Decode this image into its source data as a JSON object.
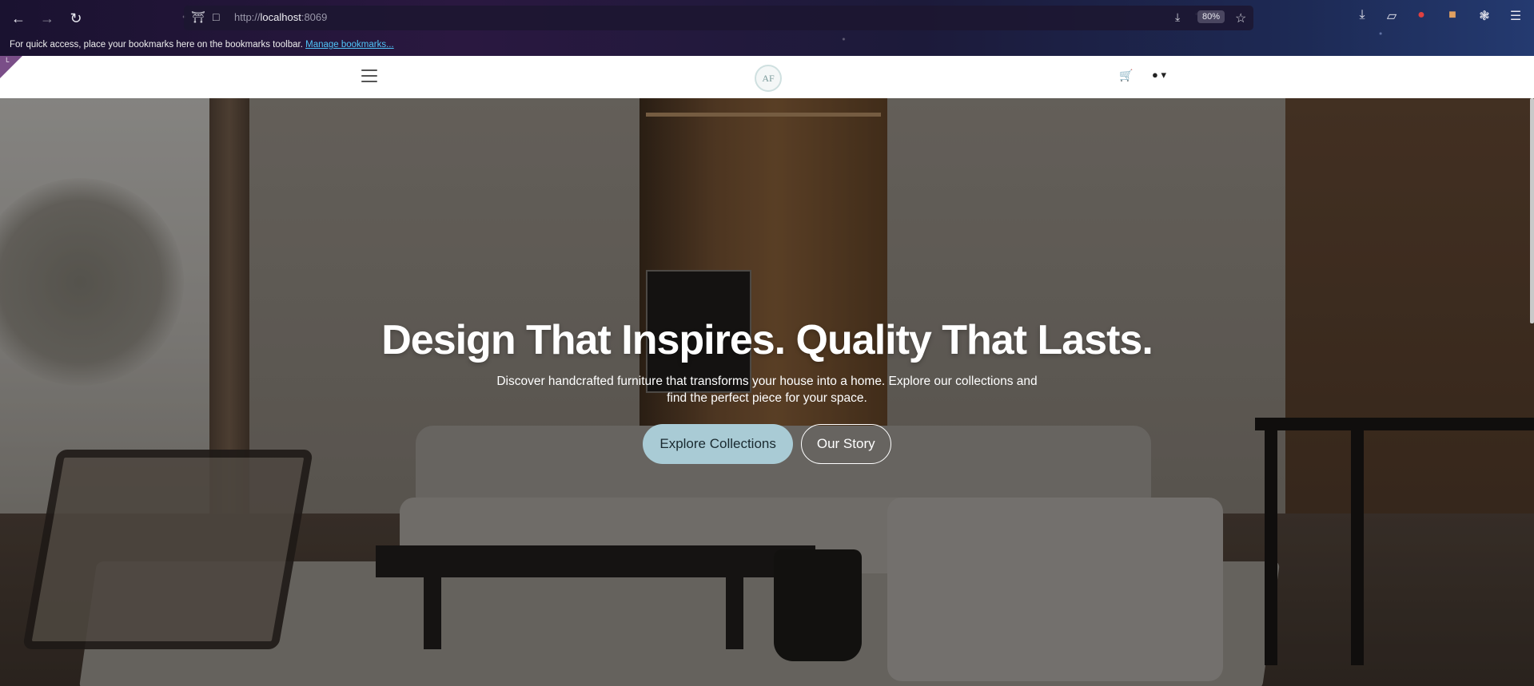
{
  "browser": {
    "url_prefix": "http://",
    "url_host": "localhost",
    "url_port": ":8069",
    "zoom": "80%",
    "bookmarks_message": "For quick access, place your bookmarks here on the bookmarks toolbar.",
    "manage_bookmarks_link": "Manage bookmarks..."
  },
  "header": {
    "logo_text": "AF"
  },
  "hero": {
    "title": "Design That Inspires. Quality That Lasts.",
    "subtitle": "Discover handcrafted furniture that transforms your house into a home. Explore our collections and find the perfect piece for your space.",
    "primary_button": "Explore Collections",
    "secondary_button": "Our Story"
  },
  "colors": {
    "primary_button_bg": "#a9cbd5",
    "corner_flag": "#7a4e88",
    "link": "#4fc3f7"
  }
}
